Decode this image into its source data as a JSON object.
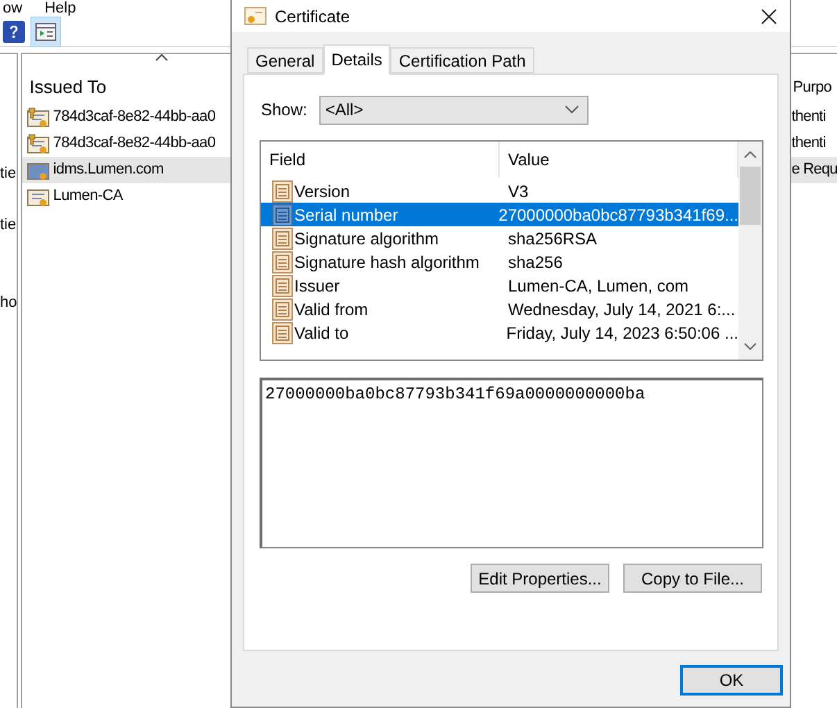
{
  "background": {
    "menu": [
      "ow",
      "Help"
    ],
    "left_pane": [
      "tie",
      "tie",
      "ho"
    ],
    "list": {
      "columns": [
        "Issued To",
        "Purpo"
      ],
      "rows": [
        {
          "issued_to": "784d3caf-8e82-44bb-aa0",
          "column_2": "thenti",
          "kind": "key",
          "selected": false
        },
        {
          "issued_to": "784d3caf-8e82-44bb-aa0",
          "column_2": "thenti",
          "kind": "key",
          "selected": false
        },
        {
          "issued_to": "idms.Lumen.com",
          "column_2": "e Requ",
          "kind": "plain",
          "selected": true
        },
        {
          "issued_to": "Lumen-CA",
          "kind": "plain",
          "selected": false
        }
      ]
    }
  },
  "dialog": {
    "title": "Certificate",
    "tabs": [
      {
        "label": "General",
        "selected": false
      },
      {
        "label": "Details",
        "selected": true
      },
      {
        "label": "Certification Path",
        "selected": false
      }
    ],
    "show": {
      "label": "Show:",
      "value": "<All>"
    },
    "fields": {
      "columns": [
        "Field",
        "Value"
      ],
      "rows": [
        {
          "field": "Version",
          "value": "V3",
          "selected": false
        },
        {
          "field": "Serial number",
          "value": "27000000ba0bc87793b341f69...",
          "selected": true
        },
        {
          "field": "Signature algorithm",
          "value": "sha256RSA",
          "selected": false
        },
        {
          "field": "Signature hash algorithm",
          "value": "sha256",
          "selected": false
        },
        {
          "field": "Issuer",
          "value": "Lumen-CA, Lumen, com",
          "selected": false
        },
        {
          "field": "Valid from",
          "value": "Wednesday, July 14, 2021 6:...",
          "selected": false
        },
        {
          "field": "Valid to",
          "value": "Friday, July 14, 2023 6:50:06 ...",
          "selected": false
        }
      ]
    },
    "detail_value": "27000000ba0bc87793b341f69a0000000000ba",
    "buttons": [
      "Edit Properties...",
      "Copy to File..."
    ],
    "ok": "OK"
  }
}
